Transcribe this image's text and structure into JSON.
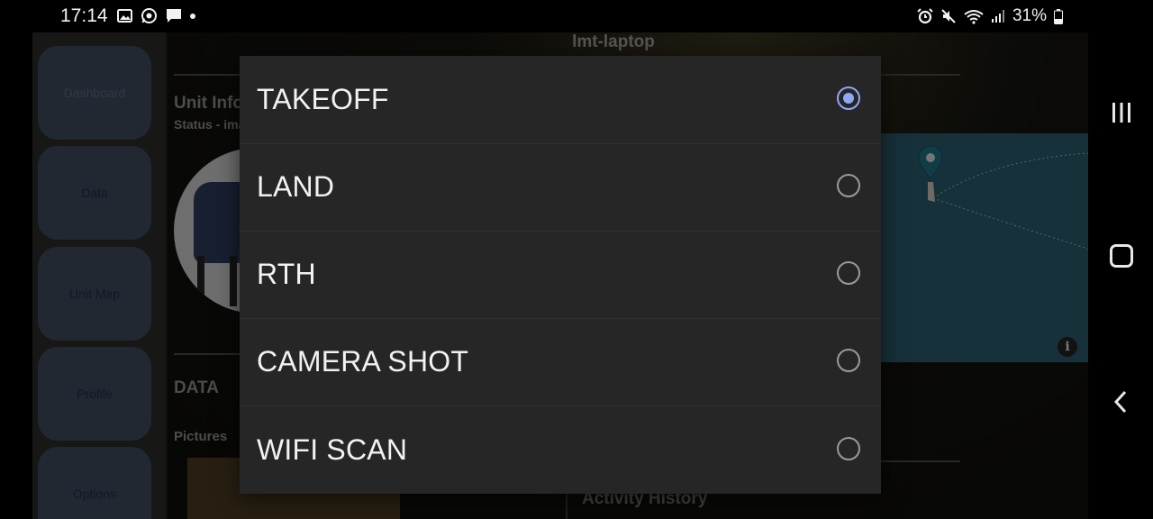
{
  "statusbar": {
    "time": "17:14",
    "battery": "31%",
    "left_icons": [
      "gallery-icon",
      "whatsapp-icon",
      "message-icon",
      "dot-icon"
    ],
    "right_icons": [
      "alarm-icon",
      "mute-icon",
      "wifi-icon",
      "signal-icon",
      "battery-icon"
    ]
  },
  "app": {
    "title": "lmt-laptop",
    "sidebar": {
      "items": [
        {
          "label": "Dashboard"
        },
        {
          "label": "Data"
        },
        {
          "label": "Unit Map"
        },
        {
          "label": "Profile"
        },
        {
          "label": "Options"
        }
      ]
    },
    "unit_info": {
      "title": "Unit Info",
      "status": "Status - ima"
    },
    "data_section": {
      "title": "DATA",
      "pictures_label": "Pictures"
    },
    "activity_history": "Activity History"
  },
  "dialog": {
    "options": [
      {
        "label": "TAKEOFF",
        "selected": true
      },
      {
        "label": "LAND",
        "selected": false
      },
      {
        "label": "RTH",
        "selected": false
      },
      {
        "label": "CAMERA SHOT",
        "selected": false
      },
      {
        "label": "WIFI SCAN",
        "selected": false
      }
    ],
    "accent_color": "#8fa8f5"
  }
}
